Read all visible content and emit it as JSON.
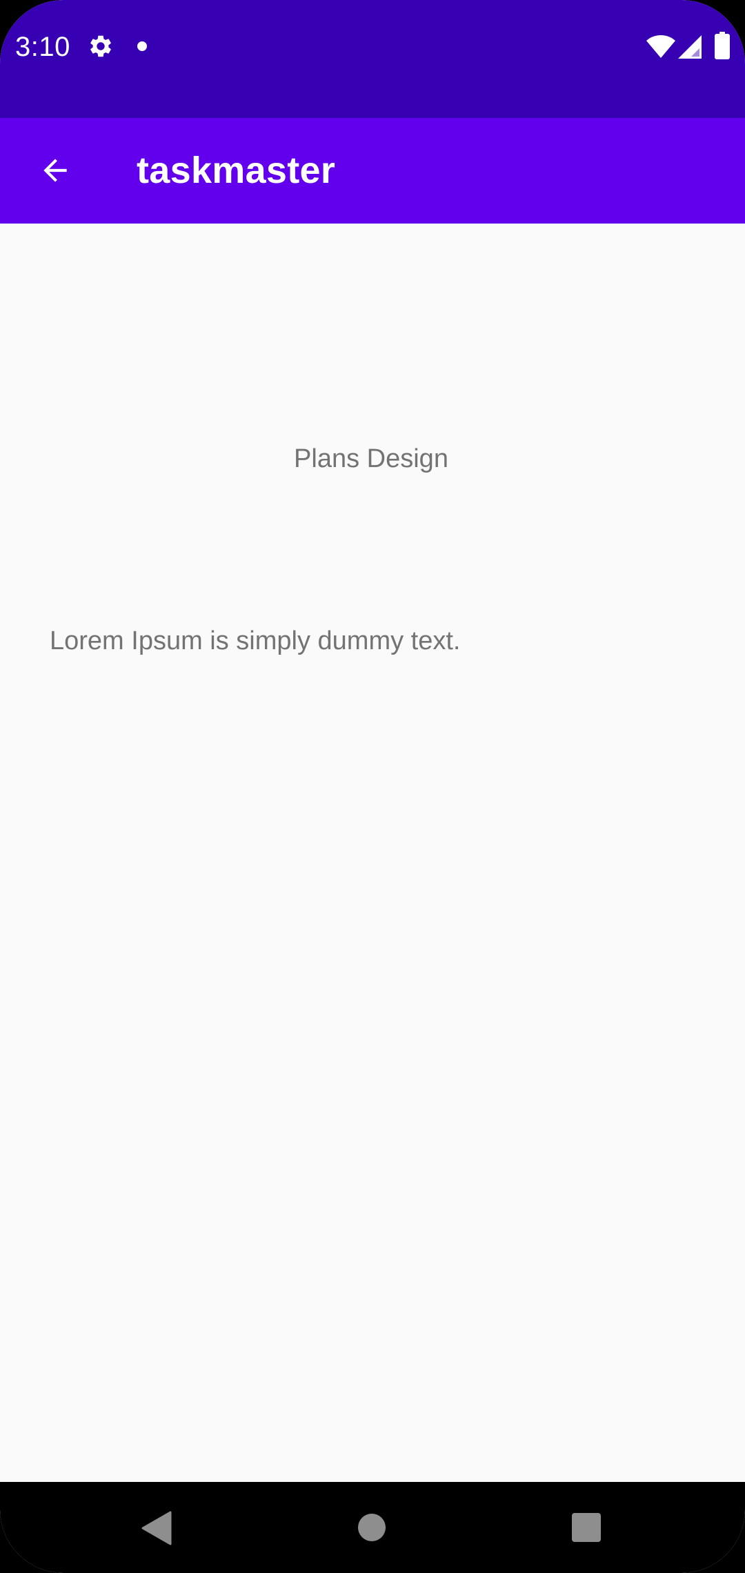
{
  "status_bar": {
    "time": "3:10",
    "icons": [
      "settings-gear-icon",
      "notification-dot-icon",
      "wifi-icon",
      "cell-signal-icon",
      "battery-icon"
    ],
    "background_color": "#3700b3"
  },
  "app_bar": {
    "title": "taskmaster",
    "back_icon": "arrow-back-icon",
    "background_color": "#6200ee"
  },
  "main": {
    "heading": "Plans Design",
    "body": "Lorem Ipsum is simply dummy text."
  },
  "nav_bar": {
    "buttons": [
      "back",
      "home",
      "recents"
    ]
  }
}
